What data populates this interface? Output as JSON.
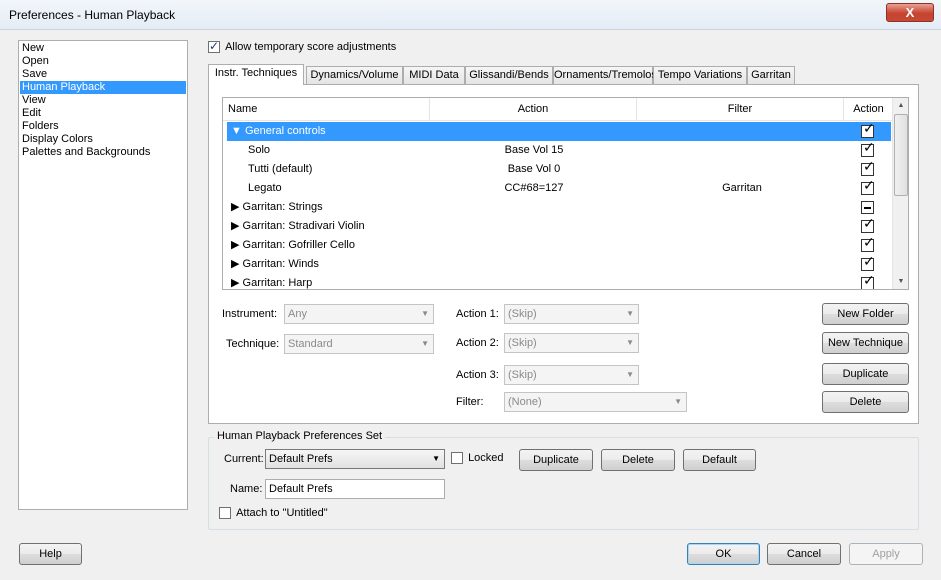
{
  "window": {
    "title": "Preferences - Human Playback",
    "close_glyph": "X"
  },
  "categories": [
    {
      "label": "New"
    },
    {
      "label": "Open"
    },
    {
      "label": "Save"
    },
    {
      "label": "Human Playback",
      "selected": true
    },
    {
      "label": "View"
    },
    {
      "label": "Edit"
    },
    {
      "label": "Folders"
    },
    {
      "label": "Display Colors"
    },
    {
      "label": "Palettes and Backgrounds"
    }
  ],
  "allow_temp": {
    "label": "Allow temporary score adjustments",
    "checked": true
  },
  "tabs": [
    {
      "label": "Instr. Techniques",
      "active": true
    },
    {
      "label": "Dynamics/Volume"
    },
    {
      "label": "MIDI Data"
    },
    {
      "label": "Glissandi/Bends"
    },
    {
      "label": "Ornaments/Tremolos"
    },
    {
      "label": "Tempo Variations"
    },
    {
      "label": "Garritan"
    }
  ],
  "grid": {
    "columns": [
      "Name",
      "Action",
      "Filter",
      "Action"
    ],
    "rows": [
      {
        "name": "▼ General controls",
        "action": "",
        "filter": "",
        "state": "checked",
        "selected": true
      },
      {
        "name": "Solo",
        "action": "Base Vol 15",
        "filter": "",
        "state": "checked"
      },
      {
        "name": "Tutti (default)",
        "action": "Base Vol 0",
        "filter": "",
        "state": "checked"
      },
      {
        "name": "Legato",
        "action": "CC#68=127",
        "filter": "Garritan",
        "state": "checked"
      },
      {
        "name": "▶ Garritan: Strings",
        "action": "",
        "filter": "",
        "state": "mixed"
      },
      {
        "name": "▶ Garritan: Stradivari Violin",
        "action": "",
        "filter": "",
        "state": "checked"
      },
      {
        "name": "▶ Garritan: Gofriller Cello",
        "action": "",
        "filter": "",
        "state": "checked"
      },
      {
        "name": "▶ Garritan: Winds",
        "action": "",
        "filter": "",
        "state": "checked"
      },
      {
        "name": "▶ Garritan: Harp",
        "action": "",
        "filter": "",
        "state": "checked"
      }
    ]
  },
  "fields": {
    "instrument_label": "Instrument:",
    "instrument_value": "Any",
    "technique_label": "Technique:",
    "technique_value": "Standard",
    "action1_label": "Action 1:",
    "action1_value": "(Skip)",
    "action2_label": "Action 2:",
    "action2_value": "(Skip)",
    "action3_label": "Action 3:",
    "action3_value": "(Skip)",
    "filter_label": "Filter:",
    "filter_value": "(None)"
  },
  "side_buttons": {
    "new_folder": "New Folder",
    "new_technique": "New Technique",
    "duplicate": "Duplicate",
    "delete": "Delete"
  },
  "prefs_set": {
    "title": "Human Playback Preferences Set",
    "current_label": "Current:",
    "current_value": "Default Prefs",
    "locked_label": "Locked",
    "locked_checked": false,
    "duplicate_label": "Duplicate",
    "delete_label": "Delete",
    "default_label": "Default",
    "name_label": "Name:",
    "name_value": "Default Prefs",
    "attach_label": "Attach to \"Untitled\"",
    "attach_checked": false
  },
  "footer": {
    "help": "Help",
    "ok": "OK",
    "cancel": "Cancel",
    "apply": "Apply"
  }
}
